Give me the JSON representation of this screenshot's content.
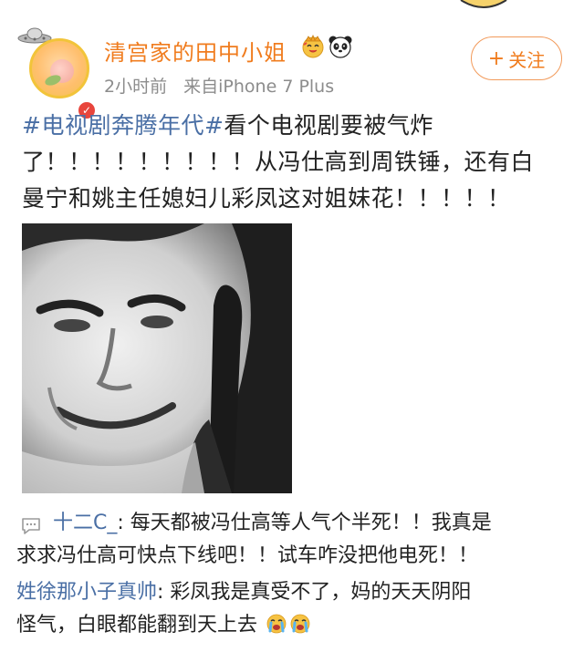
{
  "post": {
    "username": "清宫家的田中小姐",
    "time": "2小时前",
    "source": "来自iPhone 7 Plus",
    "follow_label": "关注",
    "follow_plus": "+",
    "hashtag": "#电视剧奔腾年代#",
    "text_line1_rest": "看个电视剧要被气炸",
    "text_line2": "了！！！！！！！！！从冯仕高到周铁锤，还有白",
    "text_line3": "曼宁和姚主任媳妇儿彩凤这对姐妹花！！！！！"
  },
  "comments": [
    {
      "author": "十二C_",
      "line1": ":  每天都被冯仕高等人气个半死！！我真是",
      "line2": "求求冯仕高可快点下线吧！！试车咋没把他电死！！"
    },
    {
      "author": "姓徐那小子真帅",
      "line1": ":  彩凤我是真受不了，妈的天天阴阳",
      "line2": "怪气，白眼都能翻到天上去"
    }
  ],
  "colors": {
    "username": "#f07c1e",
    "link": "#4a6fa5",
    "meta": "#8c8c8c",
    "follow_border": "#f29a5a"
  },
  "icons": [
    "ufo-icon",
    "vip-badge-icon",
    "crown-emoji-icon",
    "panda-emoji-icon",
    "comment-icon",
    "crying-emoji-icon"
  ]
}
